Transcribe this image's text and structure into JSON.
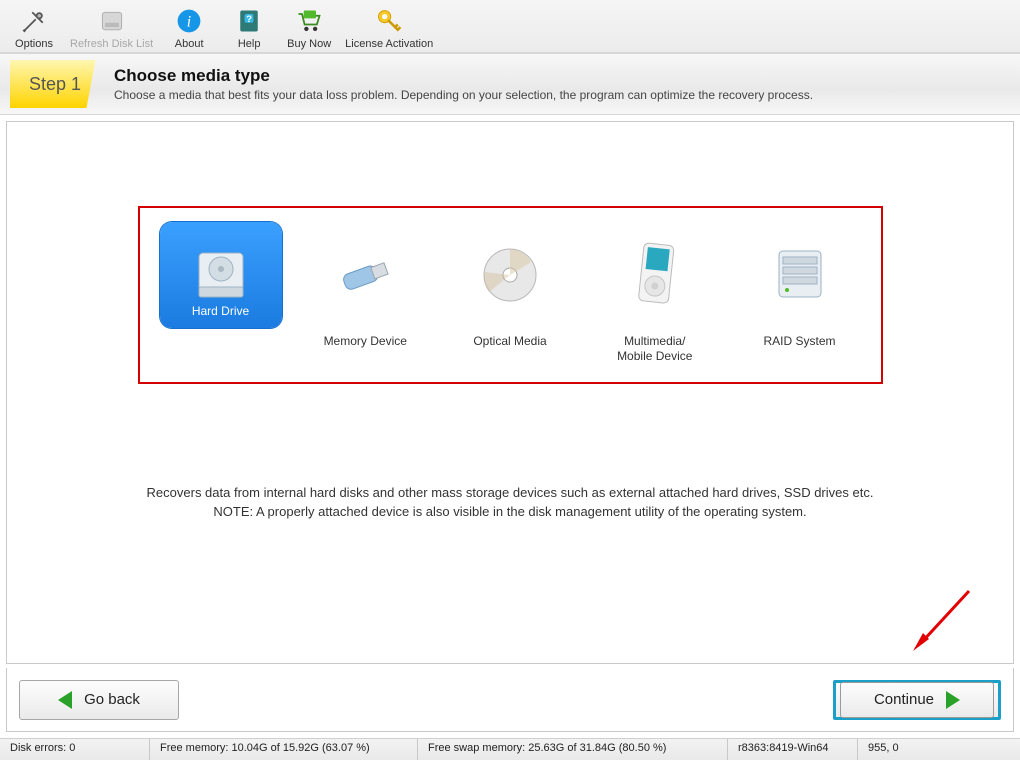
{
  "toolbar": [
    {
      "id": "options",
      "label": "Options",
      "disabled": false
    },
    {
      "id": "refresh",
      "label": "Refresh Disk List",
      "disabled": true
    },
    {
      "id": "about",
      "label": "About",
      "disabled": false
    },
    {
      "id": "help",
      "label": "Help",
      "disabled": false
    },
    {
      "id": "buy",
      "label": "Buy Now",
      "disabled": false
    },
    {
      "id": "license",
      "label": "License Activation",
      "disabled": false
    }
  ],
  "step": {
    "badge": "Step 1",
    "title": "Choose media type",
    "subtitle": "Choose a media that best fits your data loss problem. Depending on your selection, the program can optimize the recovery process."
  },
  "media": [
    {
      "id": "hdd",
      "label": "Hard Drive",
      "selected": true
    },
    {
      "id": "mem",
      "label": "Memory Device",
      "selected": false
    },
    {
      "id": "opt",
      "label": "Optical Media",
      "selected": false
    },
    {
      "id": "mob",
      "label": "Multimedia/\nMobile Device",
      "selected": false
    },
    {
      "id": "raid",
      "label": "RAID System",
      "selected": false
    }
  ],
  "description": "Recovers data from internal hard disks and other mass storage devices such as external attached hard drives, SSD drives etc.\nNOTE: A properly attached device is also visible in the disk management utility of the operating system.",
  "nav": {
    "back": "Go back",
    "continue": "Continue"
  },
  "status": {
    "errors": "Disk errors: 0",
    "mem": "Free memory: 10.04G of 15.92G (63.07 %)",
    "swap": "Free swap memory: 25.63G of 31.84G (80.50 %)",
    "build": "r8363:8419-Win64",
    "coords": "955, 0"
  }
}
